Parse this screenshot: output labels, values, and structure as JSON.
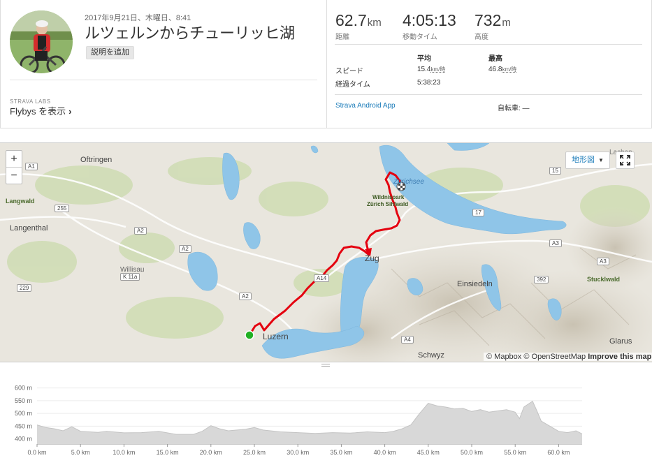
{
  "activity": {
    "date": "2017年9月21日、木曜日、8:41",
    "title": "ルツェルンからチューリッヒ湖",
    "add_description": "説明を追加",
    "labs": "STRAVA LABS",
    "flybys": "Flybys を表示",
    "flybys_chevron": "›"
  },
  "stats": {
    "distance": {
      "value": "62.7",
      "unit": "km",
      "label": "距離"
    },
    "moving_time": {
      "value": "4:05:13",
      "label": "移動タイム"
    },
    "elevation": {
      "value": "732",
      "unit": "m",
      "label": "高度"
    },
    "table_headers": {
      "avg": "平均",
      "max": "最高"
    },
    "speed": {
      "label": "スピード",
      "avg": "15.4",
      "max": "46.8",
      "unit": "km/時"
    },
    "elapsed": {
      "label": "経過タイム",
      "avg": "5:38:23"
    },
    "device": "Strava Android App",
    "bike": "自転車: —"
  },
  "map": {
    "zoom_in": "+",
    "zoom_out": "−",
    "map_type": "地形図",
    "map_type_caret": "▼",
    "attribution_1": "© Mapbox © OpenStreetMap",
    "attribution_2": "Improve this map",
    "labels": {
      "oftringen": "Oftringen",
      "langwald": "Langwald",
      "langenthal": "Langenthal",
      "willisau": "Willisau",
      "luzern": "Luzern",
      "zug": "Zug",
      "zurichsee": "Zürichsee",
      "wildnispark": "Wildnispark",
      "sihlwald": "Zürich Sihlwald",
      "einsiedeln": "Einsiedeln",
      "schwyz": "Schwyz",
      "stucklwald": "Stucklwald",
      "glarus": "Glarus",
      "lachen": "Lachen"
    },
    "shields": [
      "A1",
      "A2",
      "A2",
      "A2",
      "K 11a",
      "229",
      "255",
      "A14",
      "A4",
      "17",
      "A3",
      "A3",
      "392",
      "15"
    ],
    "colors": {
      "route": "#e4000f",
      "water": "#8fc5e8",
      "start": "#21b024"
    }
  },
  "elevation_chart": {
    "y_ticks": [
      "600 m",
      "550 m",
      "500 m",
      "450 m",
      "400 m"
    ],
    "x_ticks": [
      "0.0 km",
      "5.0 km",
      "10.0 km",
      "15.0 km",
      "20.0 km",
      "25.0 km",
      "30.0 km",
      "35.0 km",
      "40.0 km",
      "45.0 km",
      "50.0 km",
      "55.0 km",
      "60.0 km"
    ]
  },
  "chart_data": {
    "type": "area",
    "xlabel": "",
    "ylabel": "",
    "xlim": [
      0,
      62.7
    ],
    "ylim": [
      380,
      610
    ],
    "x": [
      0,
      1,
      2,
      3,
      4,
      5,
      6,
      7,
      8,
      10,
      12,
      14,
      16,
      18,
      19,
      20,
      21,
      22,
      24,
      25,
      26,
      28,
      30,
      32,
      34,
      36,
      38,
      40,
      41,
      42,
      43,
      44,
      45,
      46,
      47,
      48,
      49,
      50,
      51,
      52,
      53,
      54,
      55,
      55.5,
      56,
      57,
      57.5,
      58,
      59,
      60,
      61,
      62,
      62.7
    ],
    "values": [
      455,
      445,
      440,
      432,
      448,
      430,
      428,
      426,
      430,
      424,
      425,
      430,
      418,
      418,
      430,
      452,
      440,
      432,
      438,
      445,
      435,
      428,
      425,
      422,
      425,
      423,
      428,
      425,
      430,
      440,
      455,
      500,
      540,
      530,
      525,
      518,
      520,
      508,
      515,
      505,
      510,
      515,
      505,
      480,
      525,
      548,
      510,
      470,
      450,
      430,
      425,
      432,
      420
    ],
    "color": "#d8d8d8"
  }
}
